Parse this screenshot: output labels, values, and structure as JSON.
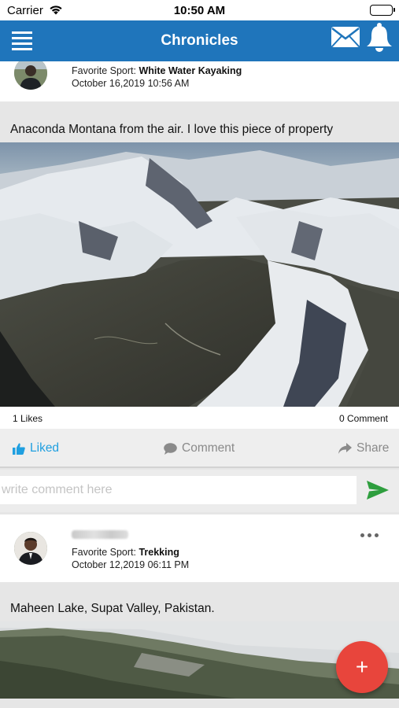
{
  "status_bar": {
    "carrier": "Carrier",
    "time": "10:50 AM"
  },
  "header": {
    "title": "Chronicles"
  },
  "posts": [
    {
      "sport_label": "Favorite Sport:",
      "sport": "White Water Kayaking",
      "date": "October 16,2019 10:56 AM",
      "caption": "Anaconda Montana from the air. I love this piece of property",
      "likes": "1 Likes",
      "comments": "0 Comment"
    },
    {
      "sport_label": "Favorite Sport:",
      "sport": "Trekking",
      "date": "October 12,2019 06:11 PM",
      "caption": "Maheen Lake, Supat Valley, Pakistan."
    }
  ],
  "actions": {
    "liked": "Liked",
    "comment": "Comment",
    "share": "Share"
  },
  "comment_input": {
    "placeholder": "write comment here"
  },
  "fab": {
    "label": "+"
  },
  "colors": {
    "nav": "#1f75bb",
    "accent_blue": "#1f9fe0",
    "send_green": "#2e9e3e",
    "fab_red": "#e8453c"
  }
}
